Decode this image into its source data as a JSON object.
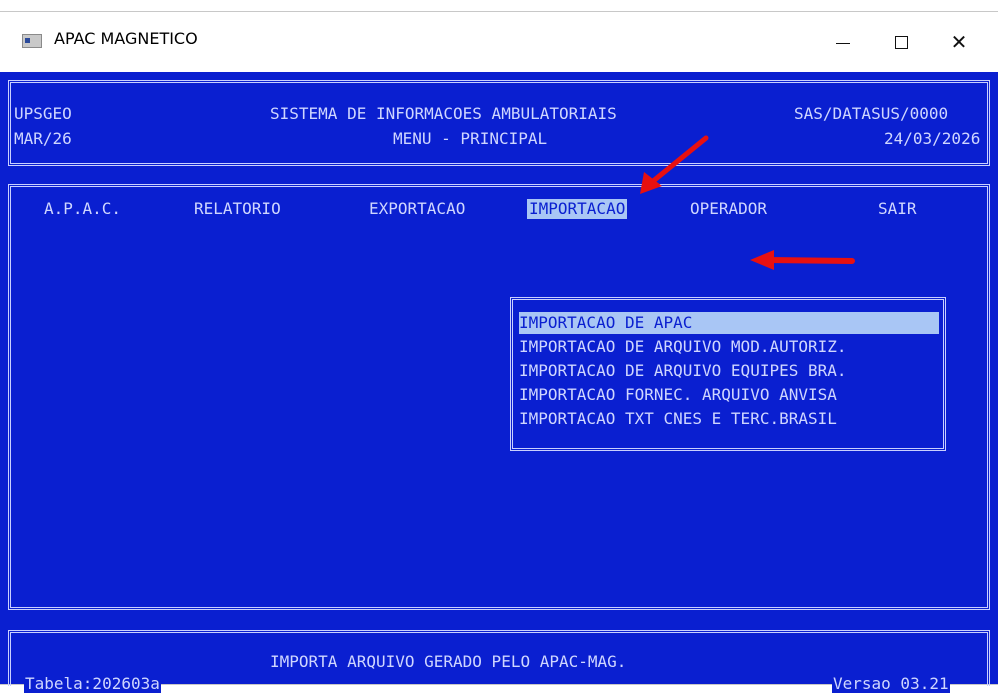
{
  "window": {
    "title": "APAC MAGNETICO",
    "controls": {
      "minimize": "—",
      "maximize": "☐",
      "close": "✕"
    }
  },
  "header": {
    "left_line1": "UPSGEO",
    "left_line2": "MAR/26",
    "center_line1": "SISTEMA DE INFORMACOES AMBULATORIAIS",
    "center_line2": "MENU - PRINCIPAL",
    "right_line1": "SAS/DATASUS/0000",
    "right_line2": "24/03/2026"
  },
  "menu": {
    "items": [
      {
        "label": "A.P.A.C."
      },
      {
        "label": "RELATORIO"
      },
      {
        "label": "EXPORTACAO"
      },
      {
        "label": "IMPORTACAO",
        "selected": true
      },
      {
        "label": "OPERADOR"
      },
      {
        "label": "SAIR"
      }
    ]
  },
  "submenu": {
    "items": [
      {
        "label": "IMPORTACAO DE APAC",
        "selected": true
      },
      {
        "label": "IMPORTACAO DE ARQUIVO MOD.AUTORIZ."
      },
      {
        "label": "IMPORTACAO DE ARQUIVO EQUIPES BRA."
      },
      {
        "label": "IMPORTACAO FORNEC. ARQUIVO ANVISA"
      },
      {
        "label": "IMPORTACAO TXT CNES E TERC.BRASIL"
      }
    ]
  },
  "footer": {
    "status": "IMPORTA ARQUIVO GERADO PELO APAC-MAG.",
    "tabela": "Tabela:202603a",
    "versao": "Versao 03.21"
  },
  "colors": {
    "background": "#0a1fd0",
    "text": "#cfd6ff",
    "highlight": "#a9c6f5",
    "annotation_arrow": "#e81010"
  }
}
